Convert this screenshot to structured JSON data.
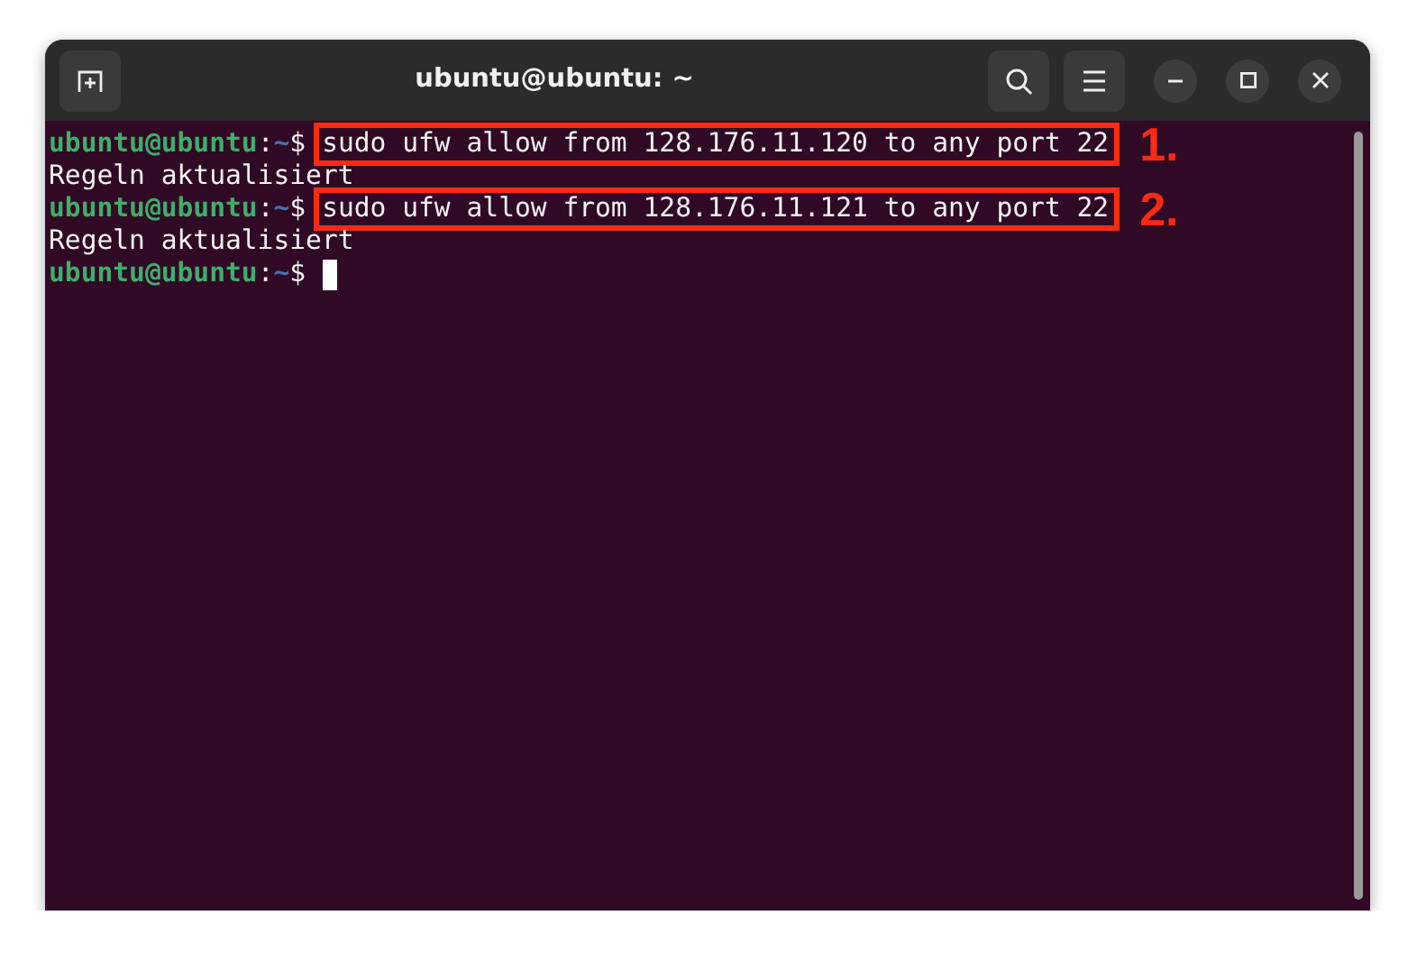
{
  "window": {
    "title": "ubuntu@ubuntu: ~"
  },
  "terminal": {
    "lines": [
      {
        "kind": "prompt",
        "user": "ubuntu@ubuntu",
        "sep": ":",
        "path": "~",
        "symbol": "$",
        "command": "sudo ufw allow from 128.176.11.120 to any port 22",
        "highlighted": true,
        "marker": "1.",
        "cursor": false
      },
      {
        "kind": "output",
        "text": "Regeln aktualisiert"
      },
      {
        "kind": "prompt",
        "user": "ubuntu@ubuntu",
        "sep": ":",
        "path": "~",
        "symbol": "$",
        "command": "sudo ufw allow from 128.176.11.121 to any port 22",
        "highlighted": true,
        "marker": "2.",
        "cursor": false
      },
      {
        "kind": "output",
        "text": "Regeln aktualisiert"
      },
      {
        "kind": "prompt",
        "user": "ubuntu@ubuntu",
        "sep": ":",
        "path": "~",
        "symbol": "$",
        "cursor": true
      }
    ]
  }
}
